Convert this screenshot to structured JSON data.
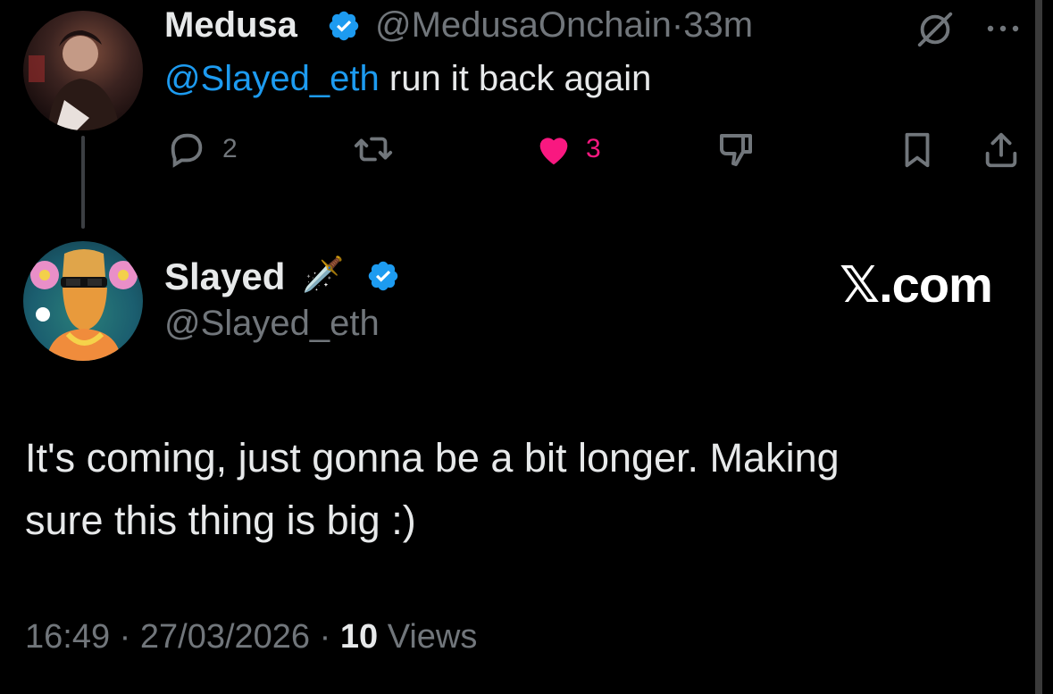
{
  "reply": {
    "author_name": "Medusa",
    "author_handle": "@MedusaOnchain",
    "separator": "·",
    "time_ago": "33m",
    "mention": "@Slayed_eth",
    "text": " run it back again",
    "actions": {
      "replies": "2",
      "reposts": "",
      "likes": "3",
      "like_color": "#f91880"
    }
  },
  "tweet": {
    "author_name": "Slayed",
    "author_emoji": "🗡️",
    "author_handle": "@Slayed_eth",
    "brand": "𝕏.com",
    "text_line1": "It's coming, just gonna be a bit longer. Making",
    "text_line2": "sure this thing is big :)",
    "time": "16:49",
    "date": "27/03/2026",
    "views_count": "10",
    "views_label": "Views",
    "dot": "·"
  },
  "colors": {
    "accent": "#1d9bf0",
    "muted": "#71767b",
    "text": "#e7e9ea",
    "background": "#000000"
  }
}
